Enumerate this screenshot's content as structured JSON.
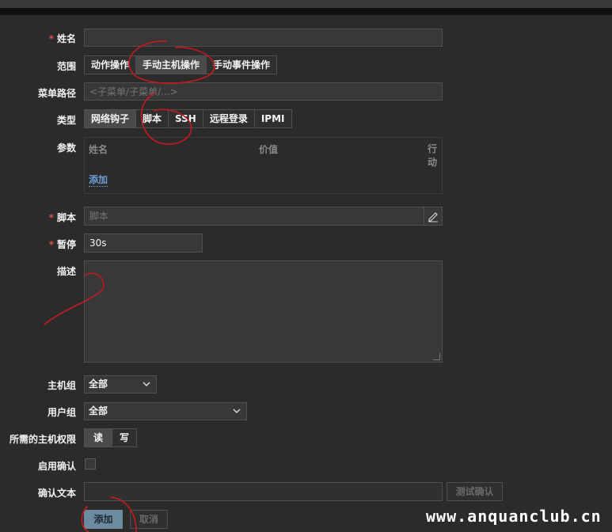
{
  "form": {
    "name": {
      "label": "姓名",
      "value": ""
    },
    "scope": {
      "label": "范围",
      "options": [
        "动作操作",
        "手动主机操作",
        "手动事件操作"
      ],
      "active": 1
    },
    "menu_path": {
      "label": "菜单路径",
      "placeholder": "<子菜单/子菜单/...>"
    },
    "type": {
      "label": "类型",
      "options": [
        "网络钩子",
        "脚本",
        "SSH",
        "远程登录",
        "IPMI"
      ],
      "active": 0
    },
    "params": {
      "label": "参数",
      "headers": {
        "name": "姓名",
        "value": "价值",
        "action": "行动"
      },
      "add_link": "添加"
    },
    "script": {
      "label": "脚本",
      "placeholder": "脚本"
    },
    "timeout": {
      "label": "暂停",
      "value": "30s"
    },
    "description": {
      "label": "描述",
      "value": ""
    },
    "host_group": {
      "label": "主机组",
      "selected": "全部"
    },
    "user_group": {
      "label": "用户组",
      "selected": "全部"
    },
    "permissions": {
      "label": "所需的主机权限",
      "options": [
        "读",
        "写"
      ],
      "active": 0
    },
    "enable_confirm": {
      "label": "启用确认",
      "checked": false
    },
    "confirm_text": {
      "label": "确认文本",
      "value": "",
      "test_button": "测试确认"
    },
    "actions": {
      "add": "添加",
      "cancel": "取消"
    }
  },
  "icons": {
    "edit": "pencil-icon",
    "chevron": "chevron-down-icon",
    "resize": "resize-handle-icon"
  },
  "colors": {
    "accent": "#6c8aa0",
    "required": "#d64e4e",
    "link": "#6ca0d4",
    "annotation": "#c8191e"
  },
  "watermark": "www.anquanclub.cn"
}
